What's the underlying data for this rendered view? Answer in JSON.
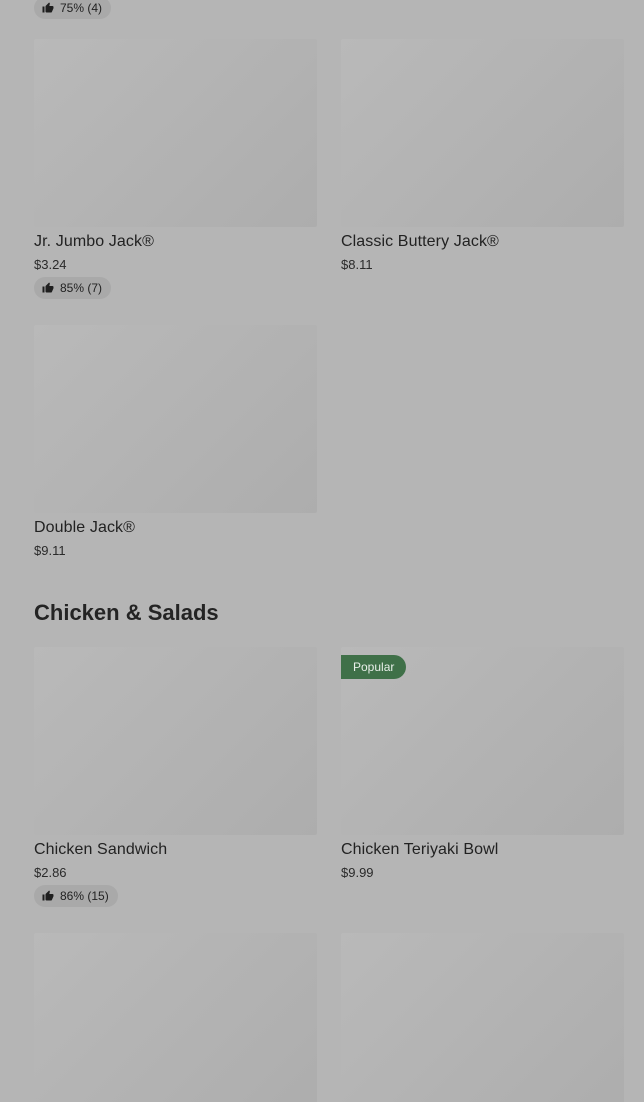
{
  "top_partial": {
    "rating": "75% (4)"
  },
  "burgers": [
    {
      "name": "Jr. Jumbo Jack®",
      "price": "$3.24",
      "rating": "85% (7)"
    },
    {
      "name": "Classic Buttery Jack®",
      "price": "$8.11"
    },
    {
      "name": "Double Jack®",
      "price": "$9.11"
    }
  ],
  "chicken_section": {
    "title": "Chicken & Salads",
    "items": [
      {
        "name": "Chicken Sandwich",
        "price": "$2.86",
        "rating": "86% (15)"
      },
      {
        "name": "Chicken Teriyaki Bowl",
        "price": "$9.99",
        "badge": "Popular"
      }
    ]
  },
  "icons": {
    "rating": "thumbs-up-icon"
  },
  "colors": {
    "background": "#b5b5b5",
    "badge": "#3f7048",
    "rating_pill": "#a9a9a9"
  }
}
